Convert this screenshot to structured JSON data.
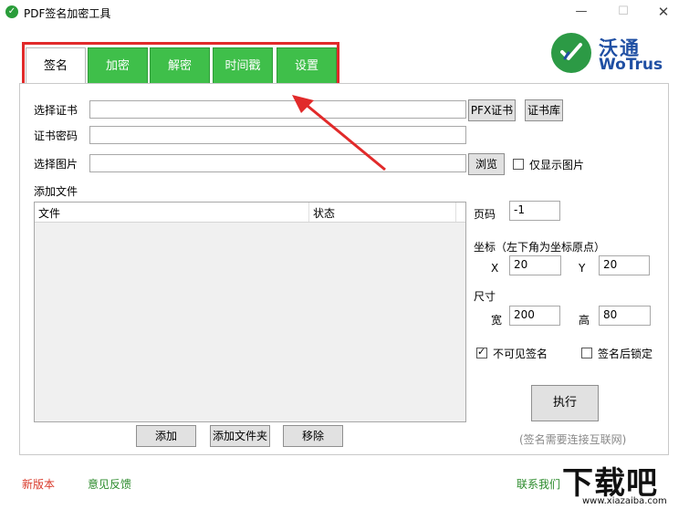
{
  "window": {
    "title": "PDF签名加密工具",
    "min_glyph": "—",
    "max_glyph": "☐",
    "close_glyph": "✕"
  },
  "logo": {
    "cn": "沃通",
    "en": "WoTrus"
  },
  "tabs": [
    {
      "label": "签名",
      "active": true
    },
    {
      "label": "加密",
      "active": false
    },
    {
      "label": "解密",
      "active": false
    },
    {
      "label": "时间戳",
      "active": false
    },
    {
      "label": "设置",
      "active": false
    }
  ],
  "form": {
    "cert_label": "选择证书",
    "cert_value": "",
    "pfx_button": "PFX证书",
    "cert_store_button": "证书库",
    "password_label": "证书密码",
    "password_value": "",
    "image_label": "选择图片",
    "image_value": "",
    "browse_button": "浏览",
    "only_image_label": "仅显示图片",
    "only_image_checked": false,
    "add_files_label": "添加文件"
  },
  "file_table": {
    "columns": [
      "文件",
      "状态"
    ],
    "rows": []
  },
  "file_buttons": {
    "add": "添加",
    "add_folder": "添加文件夹",
    "remove": "移除"
  },
  "options": {
    "page_label": "页码",
    "page_value": "-1",
    "coord_label": "坐标（左下角为坐标原点）",
    "x_label": "X",
    "x_value": "20",
    "y_label": "Y",
    "y_value": "20",
    "size_label": "尺寸",
    "width_label": "宽",
    "width_value": "200",
    "height_label": "高",
    "height_value": "80",
    "invisible_label": "不可见签名",
    "invisible_checked": true,
    "lock_label": "签名后锁定",
    "lock_checked": false,
    "execute_button": "执行",
    "network_note": "(签名需要连接互联网)"
  },
  "footer": {
    "new_version": "新版本",
    "feedback": "意见反馈",
    "contact": "联系我们"
  },
  "watermark": {
    "cn": "下载吧",
    "url": "www.xiazaiba.com"
  },
  "colors": {
    "tab_green": "#3fbf4a",
    "highlight_red": "#e12a2a",
    "logo_blue": "#1f4fa3",
    "logo_green": "#2c9a45"
  }
}
